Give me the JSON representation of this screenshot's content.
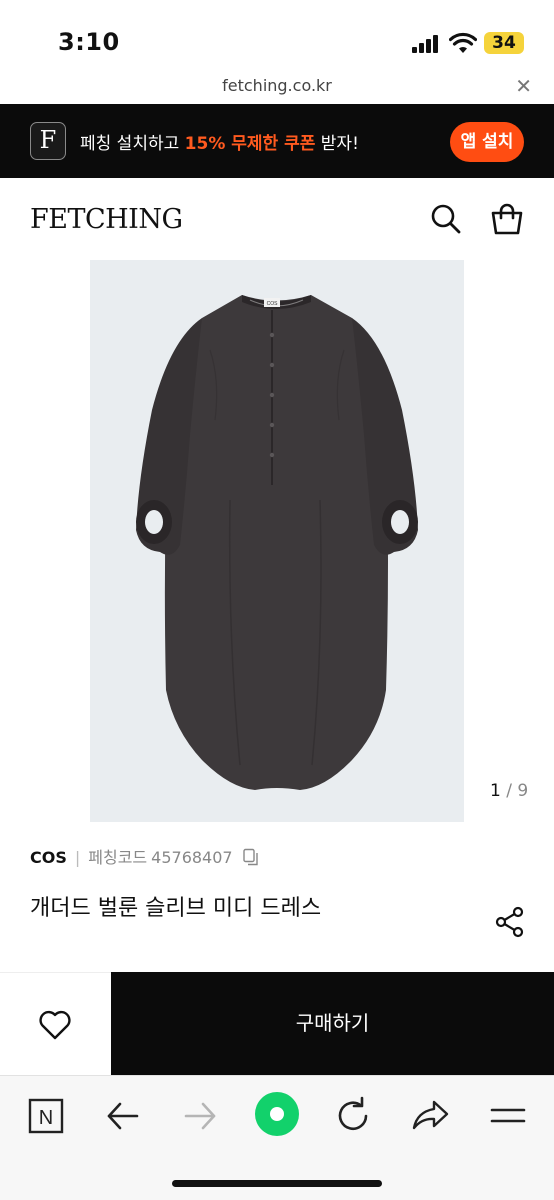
{
  "status": {
    "time": "3:10",
    "battery": "34"
  },
  "browser": {
    "url": "fetching.co.kr",
    "close_icon": "close-icon"
  },
  "banner": {
    "logo_letter": "F",
    "text_before": "페칭 설치하고 ",
    "text_highlight": "15% 무제한 쿠폰",
    "text_after": " 받자!",
    "install_label": "앱 설치",
    "highlight_color": "#ff5a1f"
  },
  "header": {
    "logo": "FETCHING",
    "search_icon": "search-icon",
    "bag_icon": "shopping-bag-icon"
  },
  "gallery": {
    "current": "1",
    "separator": " / ",
    "total": "9"
  },
  "product": {
    "brand": "COS",
    "separator": "|",
    "code_label": "페칭코드",
    "code": "45768407",
    "title": "개더드 벌룬 슬리브 미디 드레스",
    "garment_label": "COS"
  },
  "purchase": {
    "buy_label": "구매하기"
  },
  "toolbar": {
    "n_label": "N",
    "icons": [
      "naver-icon",
      "back-arrow-icon",
      "forward-arrow-icon",
      "green-dot-icon",
      "refresh-icon",
      "share-arrow-icon",
      "menu-icon"
    ]
  }
}
